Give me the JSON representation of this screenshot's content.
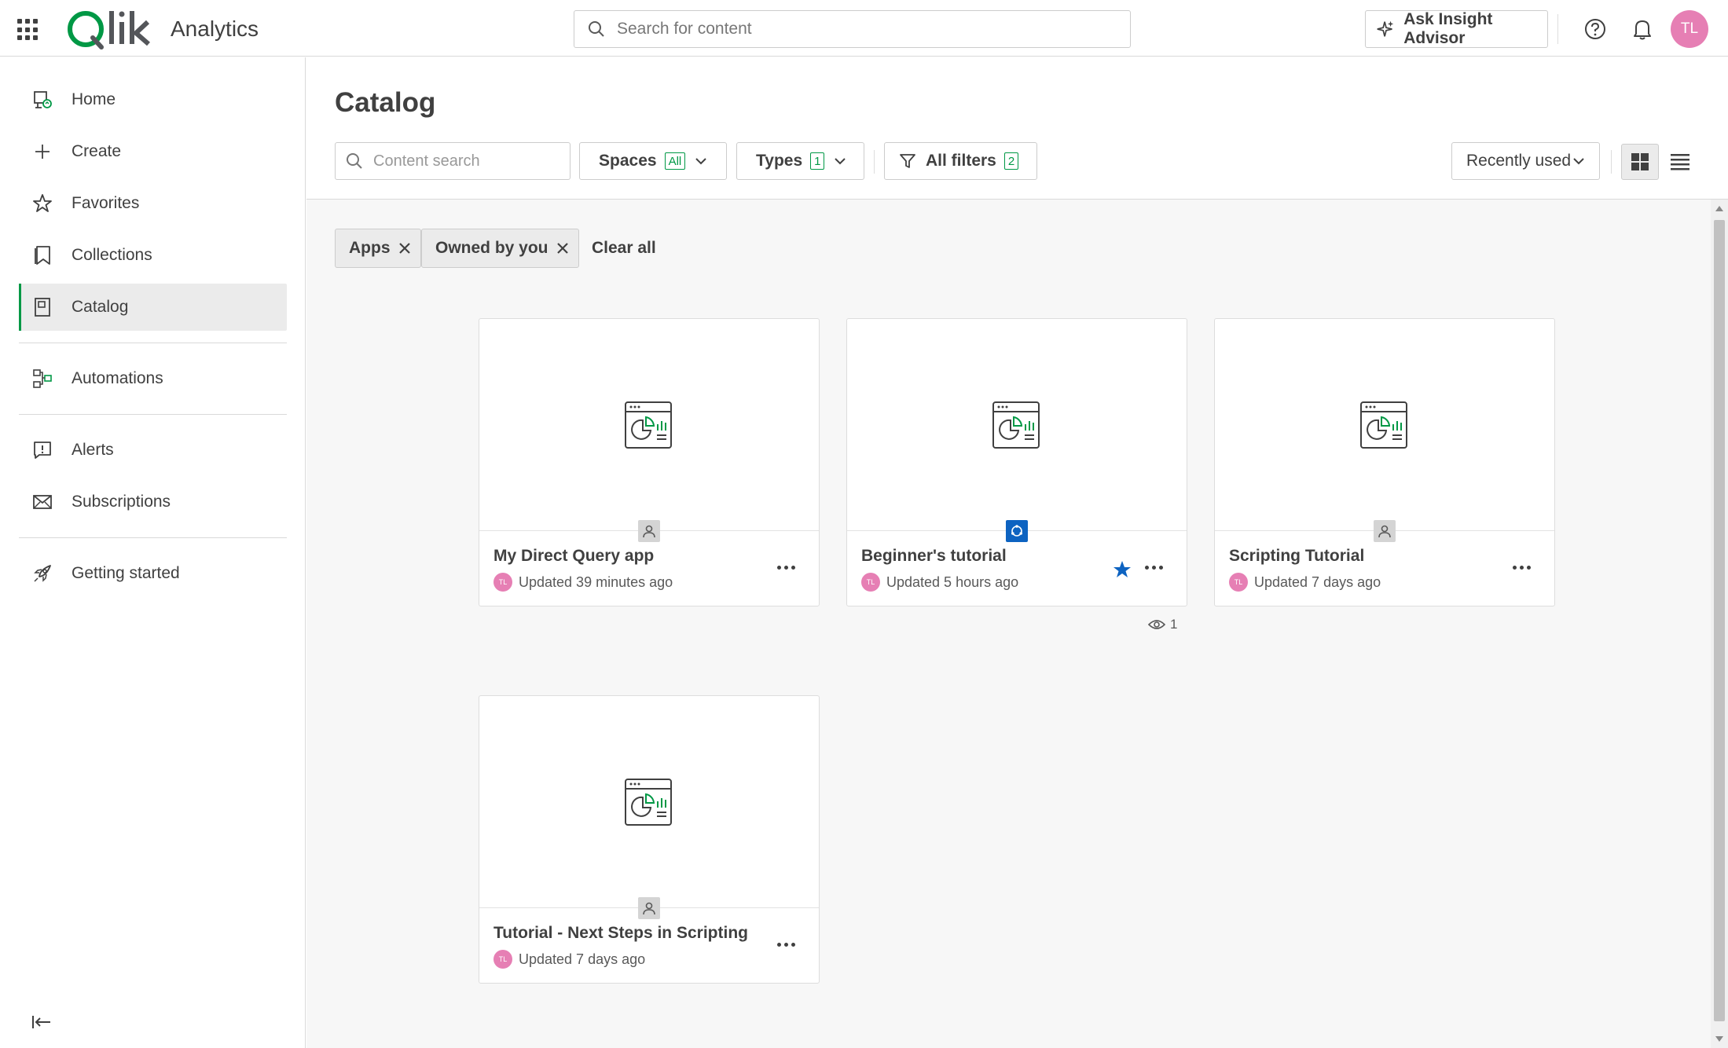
{
  "header": {
    "product_name": "Analytics",
    "search_placeholder": "Search for content",
    "insight_label": "Ask Insight Advisor",
    "user_initials": "TL"
  },
  "sidebar": {
    "items": [
      {
        "label": "Home",
        "icon": "home-icon"
      },
      {
        "label": "Create",
        "icon": "plus-icon"
      },
      {
        "label": "Favorites",
        "icon": "star-icon"
      },
      {
        "label": "Collections",
        "icon": "bookmark-icon"
      },
      {
        "label": "Catalog",
        "icon": "catalog-icon",
        "active": true
      },
      {
        "label": "Automations",
        "icon": "automation-icon"
      },
      {
        "label": "Alerts",
        "icon": "alert-icon"
      },
      {
        "label": "Subscriptions",
        "icon": "mail-icon"
      },
      {
        "label": "Getting started",
        "icon": "rocket-icon"
      }
    ]
  },
  "main": {
    "title": "Catalog",
    "content_search_placeholder": "Content search",
    "filters": {
      "spaces_label": "Spaces",
      "spaces_badge": "All",
      "types_label": "Types",
      "types_badge": "1",
      "all_filters_label": "All filters",
      "all_filters_badge": "2"
    },
    "sort_label": "Recently used",
    "chips": [
      {
        "label": "Apps"
      },
      {
        "label": "Owned by you"
      }
    ],
    "clear_all_label": "Clear all",
    "cards": [
      {
        "title": "My Direct Query app",
        "updated": "Updated 39 minutes ago",
        "initials": "TL",
        "owner": "personal",
        "favorite": false
      },
      {
        "title": "Beginner's tutorial",
        "updated": "Updated 5 hours ago",
        "initials": "TL",
        "owner": "shared",
        "favorite": true,
        "views": "1"
      },
      {
        "title": "Scripting Tutorial",
        "updated": "Updated 7 days ago",
        "initials": "TL",
        "owner": "personal",
        "favorite": false
      },
      {
        "title": "Tutorial - Next Steps in Scripting",
        "updated": "Updated 7 days ago",
        "initials": "TL",
        "owner": "personal",
        "favorite": false
      }
    ]
  },
  "colors": {
    "brand_green": "#009845",
    "avatar_pink": "#e67fb4",
    "shared_blue": "#0d63c1",
    "favorite_blue": "#0d63c1"
  }
}
